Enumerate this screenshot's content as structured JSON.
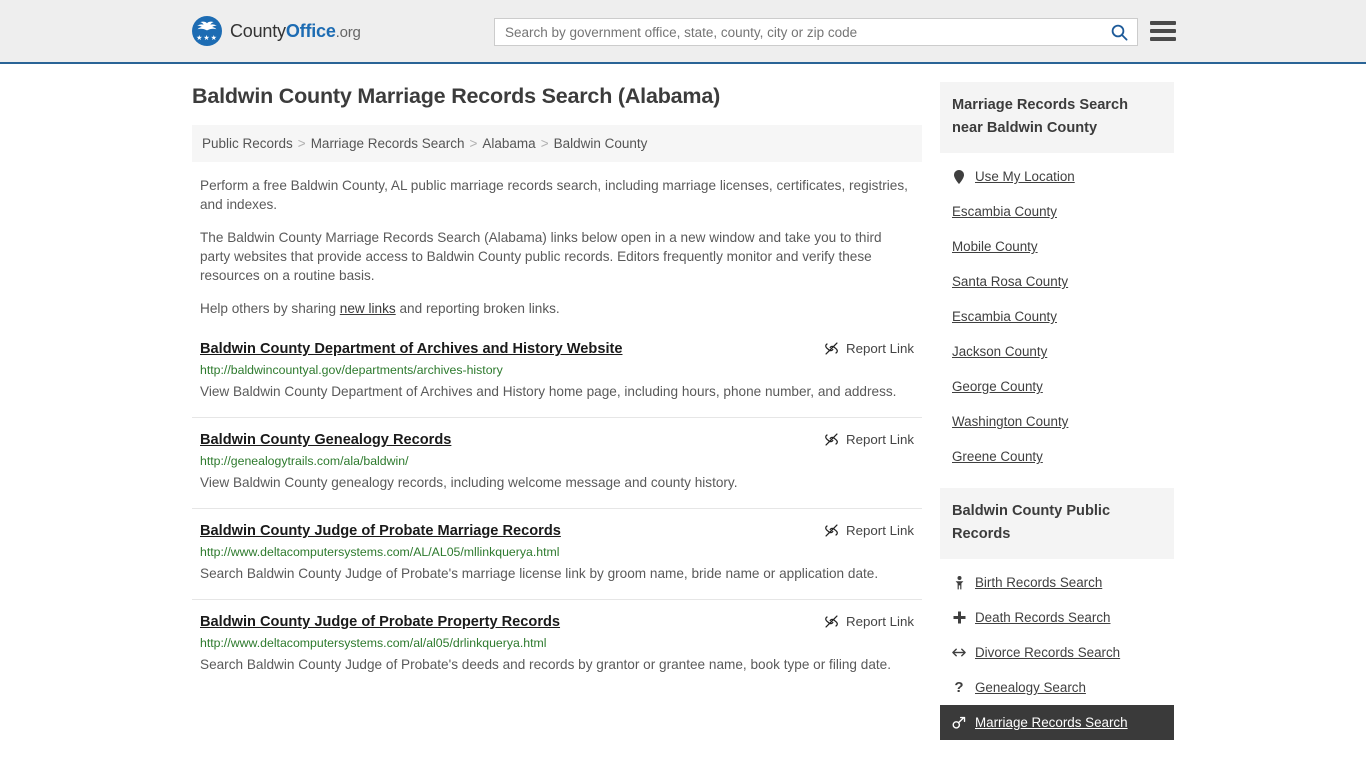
{
  "header": {
    "logo": {
      "text_county": "County",
      "text_office": "Office",
      "text_tld": ".org",
      "icon": "eagle-seal-icon"
    },
    "search": {
      "placeholder": "Search by government office, state, county, city or zip code",
      "value": "",
      "button_icon": "search-icon"
    },
    "menu_icon": "hamburger-menu-icon"
  },
  "page": {
    "title": "Baldwin County Marriage Records Search (Alabama)"
  },
  "breadcrumb": {
    "items": [
      {
        "label": "Public Records"
      },
      {
        "label": "Marriage Records Search"
      },
      {
        "label": "Alabama"
      },
      {
        "label": "Baldwin County"
      }
    ],
    "separator": ">"
  },
  "intro": {
    "p1": "Perform a free Baldwin County, AL public marriage records search, including marriage licenses, certificates, registries, and indexes.",
    "p2": "The Baldwin County Marriage Records Search (Alabama) links below open in a new window and take you to third party websites that provide access to Baldwin County public records. Editors frequently monitor and verify these resources on a routine basis.",
    "p3_before": "Help others by sharing ",
    "p3_link": "new links",
    "p3_after": " and reporting broken links."
  },
  "results": {
    "report_label": "Report Link",
    "report_icon": "broken-link-icon",
    "items": [
      {
        "title": "Baldwin County Department of Archives and History Website",
        "url": "http://baldwincountyal.gov/departments/archives-history",
        "description": "View Baldwin County Department of Archives and History home page, including hours, phone number, and address."
      },
      {
        "title": "Baldwin County Genealogy Records",
        "url": "http://genealogytrails.com/ala/baldwin/",
        "description": "View Baldwin County genealogy records, including welcome message and county history."
      },
      {
        "title": "Baldwin County Judge of Probate Marriage Records",
        "url": "http://www.deltacomputersystems.com/AL/AL05/mllinkquerya.html",
        "description": "Search Baldwin County Judge of Probate's marriage license link by groom name, bride name or application date."
      },
      {
        "title": "Baldwin County Judge of Probate Property Records",
        "url": "http://www.deltacomputersystems.com/al/al05/drlinkquerya.html",
        "description": "Search Baldwin County Judge of Probate's deeds and records by grantor or grantee name, book type or filing date."
      }
    ]
  },
  "sidebar": {
    "nearby": {
      "heading": "Marriage Records Search near Baldwin County",
      "items": [
        {
          "label": "Use My Location",
          "icon": "map-pin-icon"
        },
        {
          "label": "Escambia County",
          "icon": ""
        },
        {
          "label": "Mobile County",
          "icon": ""
        },
        {
          "label": "Santa Rosa County",
          "icon": ""
        },
        {
          "label": "Escambia County",
          "icon": ""
        },
        {
          "label": "Jackson County",
          "icon": ""
        },
        {
          "label": "George County",
          "icon": ""
        },
        {
          "label": "Washington County",
          "icon": ""
        },
        {
          "label": "Greene County",
          "icon": ""
        }
      ]
    },
    "public_records": {
      "heading": "Baldwin County Public Records",
      "items": [
        {
          "label": "Birth Records Search",
          "icon": "baby-icon",
          "glyph": "Д",
          "active": false
        },
        {
          "label": "Death Records Search",
          "icon": "cross-plus-icon",
          "glyph": "✚",
          "active": false
        },
        {
          "label": "Divorce Records Search",
          "icon": "arrows-left-right-icon",
          "glyph": "↔",
          "active": false
        },
        {
          "label": "Genealogy Search",
          "icon": "question-mark-icon",
          "glyph": "?",
          "active": false
        },
        {
          "label": "Marriage Records Search",
          "icon": "venus-mars-icon",
          "glyph": "⚥",
          "active": true
        }
      ]
    }
  },
  "colors": {
    "brand_blue": "#1d6cb3",
    "header_bg": "#eeeeee",
    "header_border": "#2a6496",
    "url_green": "#2d7a2d",
    "active_bg": "#3a3a3a"
  }
}
